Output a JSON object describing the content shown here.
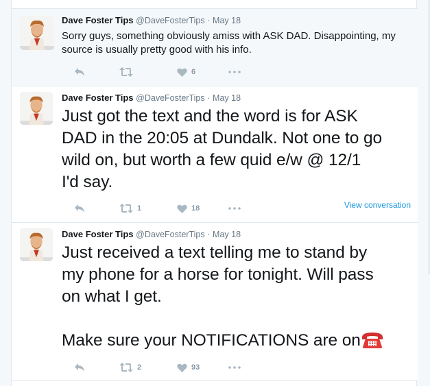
{
  "tweets": [
    {
      "name": "Dave Foster Tips",
      "handle": "@DaveFosterTips",
      "separator": "·",
      "date": "May 18",
      "text": "Sorry guys, something obviously amiss with ASK DAD. Disappointing, my source is usually pretty good with his info.",
      "retweets": "",
      "likes": "6",
      "view_conversation": ""
    },
    {
      "name": "Dave Foster Tips",
      "handle": "@DaveFosterTips",
      "separator": "·",
      "date": "May 18",
      "text_lines": [
        "Just got the text and the word is for ASK",
        "DAD in the 20:05 at Dundalk. Not one to go",
        "wild on, but worth a few quid e/w @ 12/1",
        "I'd say."
      ],
      "retweets": "1",
      "likes": "18",
      "view_conversation": "View conversation"
    },
    {
      "name": "Dave Foster Tips",
      "handle": "@DaveFosterTips",
      "separator": "·",
      "date": "May 18",
      "text_lines": [
        "Just received a text telling me to stand by",
        "my phone for a horse for tonight. Will pass",
        "on what I get."
      ],
      "text_line_last": "Make sure your NOTIFICATIONS are on",
      "emoji": "telephone-icon",
      "retweets": "2",
      "likes": "93",
      "view_conversation": ""
    }
  ],
  "colors": {
    "action_gray": "#aab8c2",
    "link_blue": "#1b95e0",
    "text": "#14171a",
    "meta": "#657786"
  }
}
